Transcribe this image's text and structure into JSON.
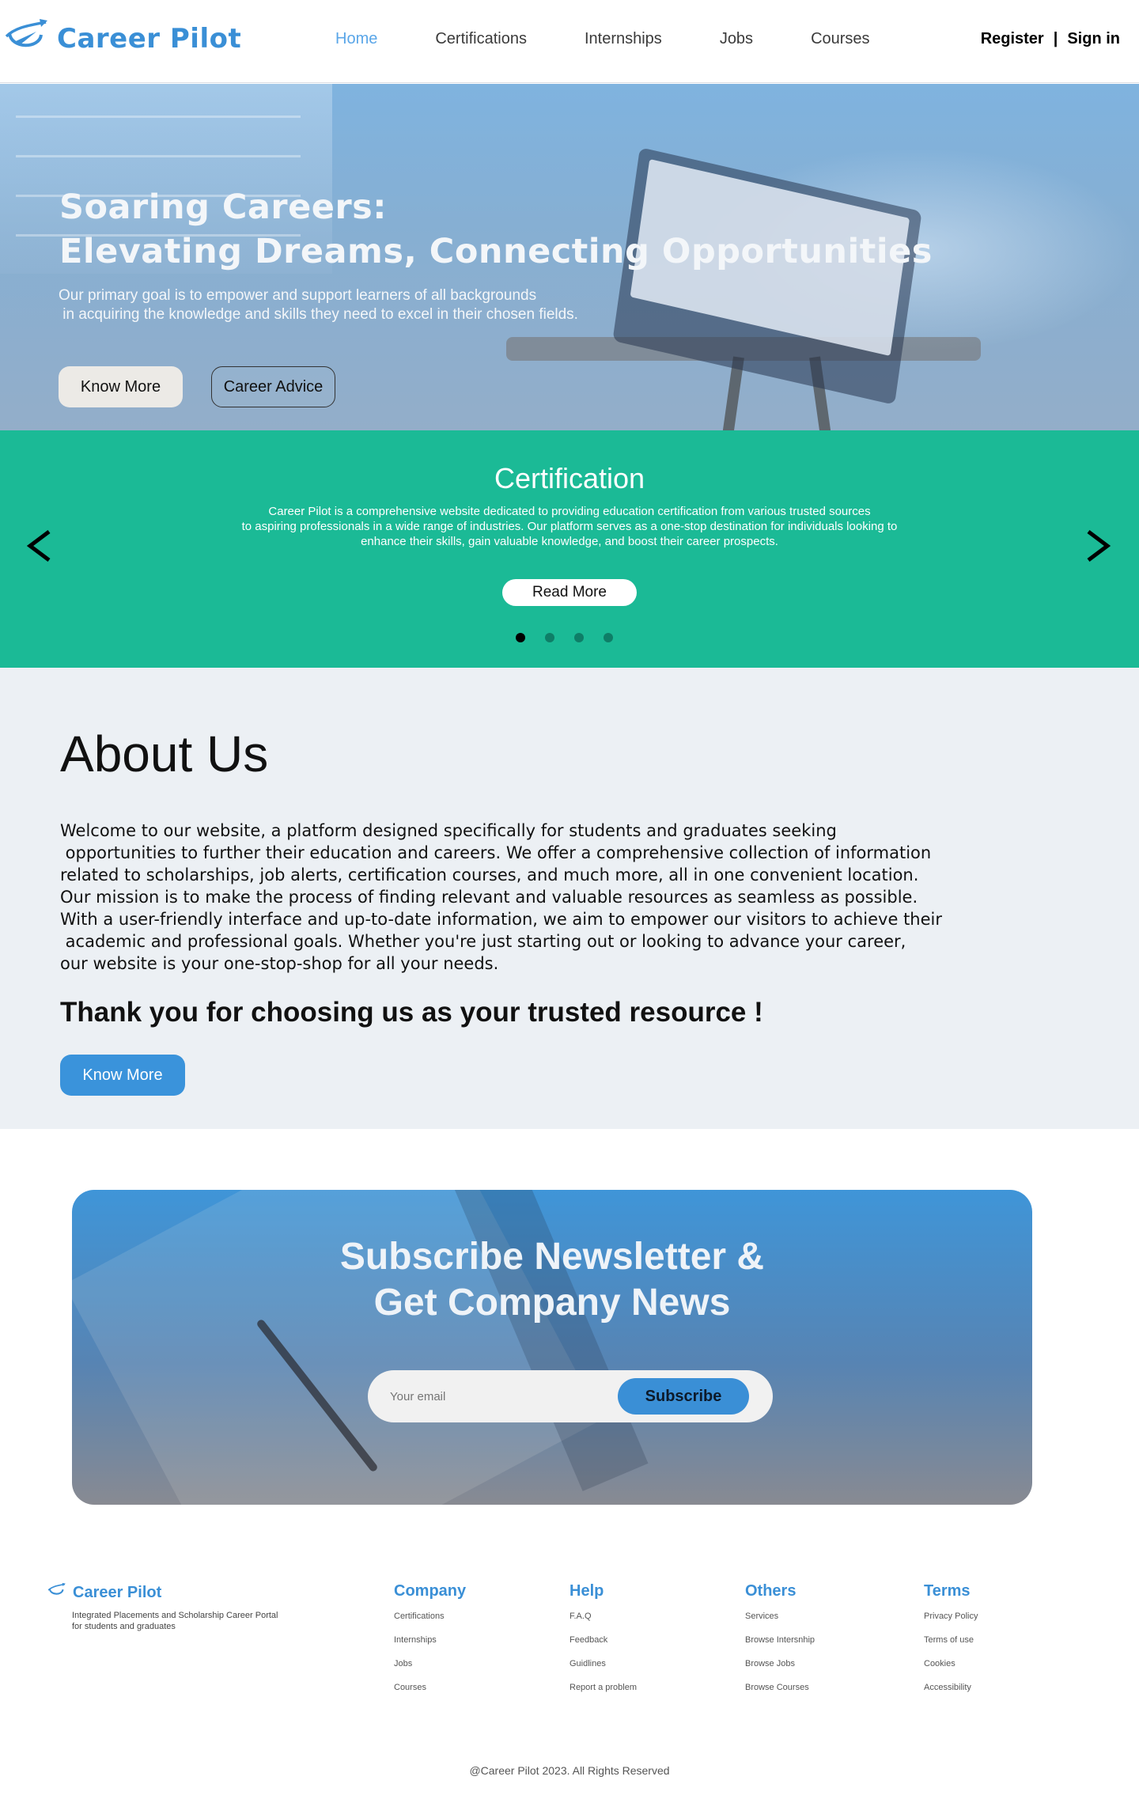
{
  "nav": {
    "brand": "Career Pilot",
    "items": [
      {
        "label": "Home",
        "active": true
      },
      {
        "label": "Certifications",
        "active": false
      },
      {
        "label": "Internships",
        "active": false
      },
      {
        "label": "Jobs",
        "active": false
      },
      {
        "label": "Courses",
        "active": false
      }
    ],
    "register": "Register",
    "separator": "|",
    "signin": "Sign in"
  },
  "hero": {
    "title_line1": "Soaring Careers:",
    "title_line2": "Elevating Dreams, Connecting Opportunities",
    "subtitle": "Our primary goal is to empower and support learners of all backgrounds\n in acquiring the knowledge and skills they need to excel in their chosen fields.",
    "primary_button": "Know More",
    "secondary_button": "Career Advice"
  },
  "carousel": {
    "title": "Certification",
    "text": "Career Pilot is a comprehensive website dedicated to providing education certification from various trusted sources\nto aspiring professionals in a wide range of industries. Our platform serves as a one-stop destination for individuals looking to\nenhance their skills, gain valuable knowledge, and boost their career prospects.",
    "button": "Read More",
    "prev_icon": "chevron-left-icon",
    "next_icon": "chevron-right-icon",
    "slide_count": 4,
    "active_slide": 1
  },
  "about": {
    "title": "About Us",
    "body": "Welcome to our website, a platform designed specifically for students and graduates seeking\n opportunities to further their education and careers. We offer a comprehensive collection of information\nrelated to scholarships, job alerts, certification courses, and much more, all in one convenient location.\nOur mission is to make the process of finding relevant and valuable resources as seamless as possible.\nWith a user-friendly interface and up-to-date information, we aim to empower our visitors to achieve their\n academic and professional goals. Whether you're just starting out or looking to advance your career,\nour website is your one-stop-shop for all your needs.",
    "tagline": "Thank you for choosing us as your trusted resource !",
    "button": "Know More"
  },
  "newsletter": {
    "title_line1": "Subscribe Newsletter &",
    "title_line2": "Get Company News",
    "placeholder": "Your email",
    "button": "Subscribe"
  },
  "footer": {
    "brand": "Career Pilot",
    "tagline": "Integrated Placements and Scholarship Career Portal\nfor students and graduates",
    "columns": [
      {
        "title": "Company",
        "links": [
          "Certifications",
          "Internships",
          "Jobs",
          "Courses"
        ]
      },
      {
        "title": "Help",
        "links": [
          "F.A.Q",
          "Feedback",
          "Guidlines",
          "Report a problem"
        ]
      },
      {
        "title": "Others",
        "links": [
          "Services",
          "Browse Intersnhip",
          "Browse Jobs",
          "Browse Courses"
        ]
      },
      {
        "title": "Terms",
        "links": [
          "Privacy Policy",
          "Terms of use",
          "Cookies",
          "Accessibility"
        ]
      }
    ],
    "copyright": "@Career Pilot 2023. All Rights Reserved"
  },
  "colors": {
    "brand_blue": "#3a8fd6",
    "nav_active": "#5aa6e8",
    "carousel_green": "#1bba96",
    "about_bg": "#ecf0f4"
  }
}
